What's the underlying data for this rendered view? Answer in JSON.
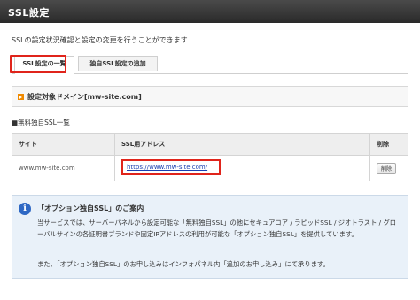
{
  "header": {
    "title": "SSL設定"
  },
  "description": "SSLの設定状況確認と設定の変更を行うことができます",
  "tabs": [
    {
      "label": "SSL設定の一覧",
      "active": true
    },
    {
      "label": "独自SSL設定の追加",
      "active": false
    }
  ],
  "domain_bar": {
    "label": "設定対象ドメイン[mw-site.com]"
  },
  "section_label": "■無料独自SSL一覧",
  "table": {
    "headers": [
      "サイト",
      "SSL用アドレス",
      "削除"
    ],
    "rows": [
      {
        "site": "www.mw-site.com",
        "url": "https://www.mw-site.com/",
        "delete_label": "削除"
      }
    ]
  },
  "info": {
    "title": "「オプション独自SSL」のご案内",
    "para1": "当サービスでは、サーバーパネルから設定可能な「無料独自SSL」の他にセキュアコア / ラピッドSSL / ジオトラスト / グローバルサインの各証明書ブランドや固定IPアドレスの利用が可能な「オプション独自SSL」を提供しています。",
    "para2": "また、「オプション独自SSL」のお申し込みはインフォパネル内「追加のお申し込み」にて承ります。"
  },
  "colors": {
    "highlight": "#e0241b",
    "header_bg": "#333333",
    "info_bg": "#e9f1f9",
    "link": "#1a3fb0",
    "accent": "#f08a00"
  },
  "icons": {
    "info": "info-icon",
    "arrow": "arrow-right-icon"
  }
}
